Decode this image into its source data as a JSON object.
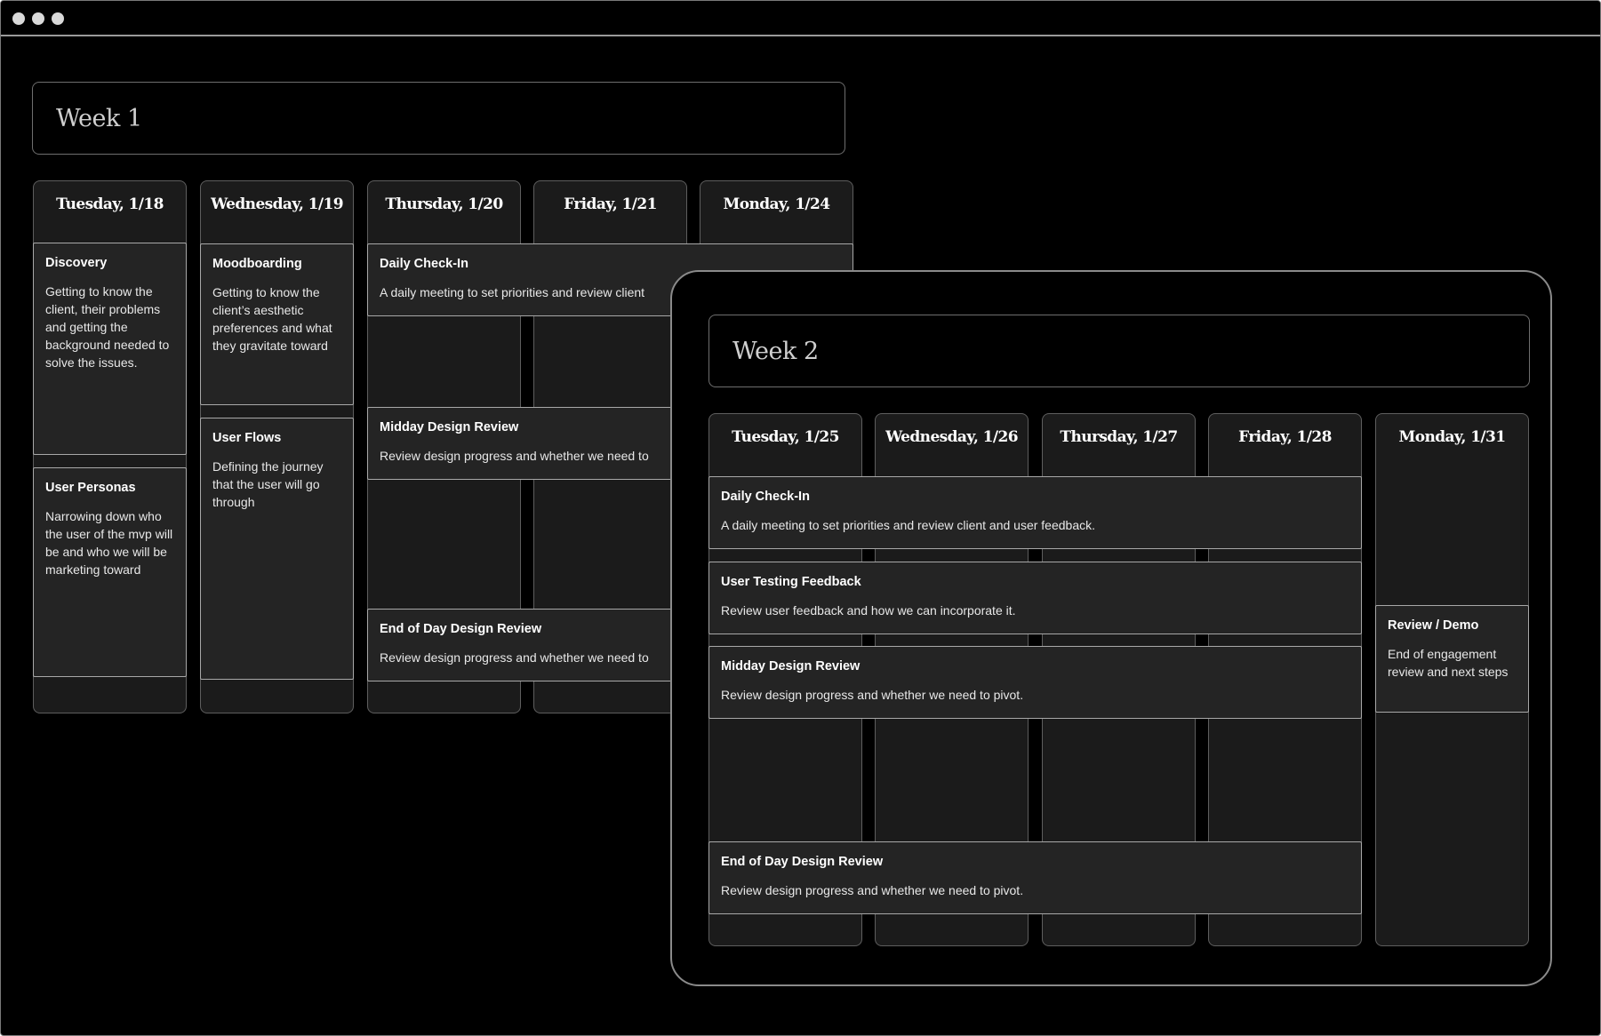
{
  "colors": {
    "background": "#000000",
    "column": "#1b1b1b",
    "card": "#242424",
    "border": "#a8a8a8",
    "text": "#ffffff"
  },
  "week1": {
    "title": "Week 1",
    "days": [
      "Tuesday, 1/18",
      "Wednesday, 1/19",
      "Thursday, 1/20",
      "Friday, 1/21",
      "Monday, 1/24"
    ],
    "cards": {
      "discovery": {
        "title": "Discovery",
        "desc": "Getting to know the client, their problems and getting the background needed to solve the issues."
      },
      "moodboarding": {
        "title": "Moodboarding",
        "desc": "Getting to know the client’s aesthetic preferences and what they gravitate toward"
      },
      "personas": {
        "title": "User Personas",
        "desc": "Narrowing down who the user of the mvp will be and who we will be marketing toward"
      },
      "flows": {
        "title": "User Flows",
        "desc": "Defining the journey that the user will go through"
      },
      "checkin": {
        "title": "Daily Check-In",
        "desc": "A daily meeting to set priorities and review client"
      },
      "midday": {
        "title": "Midday Design Review",
        "desc": "Review design progress and whether we need to"
      },
      "eod": {
        "title": "End of Day Design Review",
        "desc": "Review design progress and whether we need to"
      }
    }
  },
  "week2": {
    "title": "Week 2",
    "days": [
      "Tuesday, 1/25",
      "Wednesday, 1/26",
      "Thursday, 1/27",
      "Friday, 1/28",
      "Monday, 1/31"
    ],
    "cards": {
      "checkin": {
        "title": "Daily Check-In",
        "desc": "A daily meeting to set priorities and review client and user feedback."
      },
      "testing": {
        "title": "User Testing Feedback",
        "desc": "Review user feedback and how we can incorporate it."
      },
      "midday": {
        "title": "Midday Design Review",
        "desc": "Review design progress and whether we need to pivot."
      },
      "eod": {
        "title": "End of Day Design Review",
        "desc": "Review design progress and whether we need to pivot."
      },
      "demo": {
        "title": "Review / Demo",
        "desc": "End of engagement review and next steps"
      }
    }
  }
}
